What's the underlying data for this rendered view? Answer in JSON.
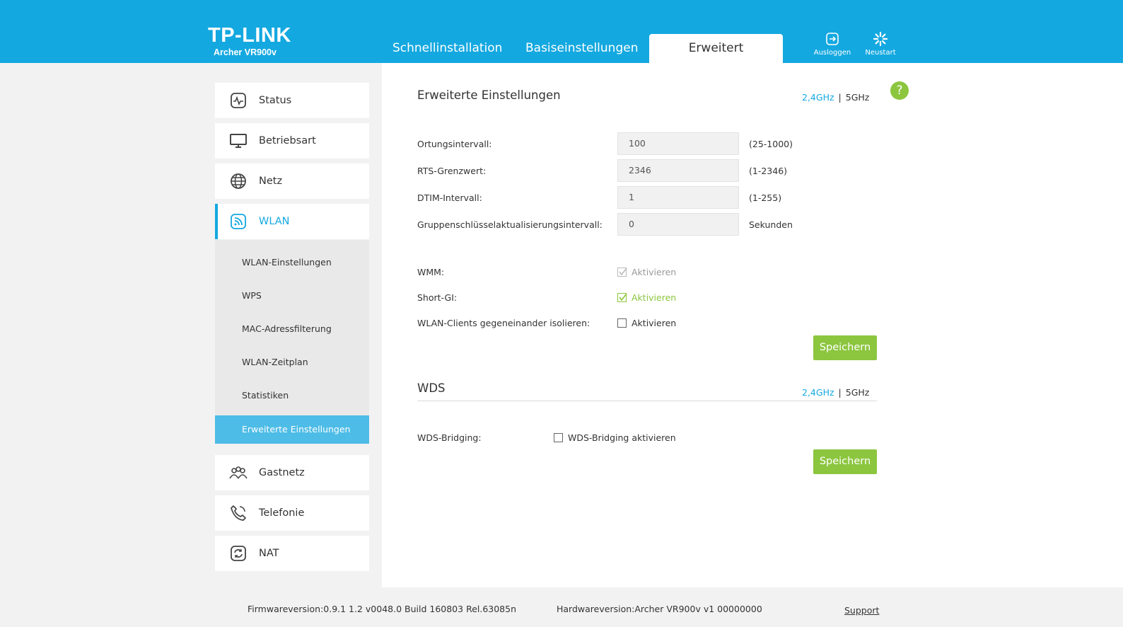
{
  "header": {
    "brand": "TP-LINK",
    "model": "Archer VR900v",
    "tabs": [
      "Schnellinstallation",
      "Basiseinstellungen",
      "Erweitert"
    ],
    "logout_label": "Ausloggen",
    "reboot_label": "Neustart",
    "color": "#14a8e0"
  },
  "sidebar": {
    "items": [
      {
        "label": "Status",
        "icon": "status-icon"
      },
      {
        "label": "Betriebsart",
        "icon": "monitor-icon"
      },
      {
        "label": "Netz",
        "icon": "globe-icon"
      },
      {
        "label": "WLAN",
        "icon": "wifi-icon"
      },
      {
        "label": "Gastnetz",
        "icon": "guests-icon"
      },
      {
        "label": "Telefonie",
        "icon": "phone-icon"
      },
      {
        "label": "NAT",
        "icon": "nat-icon"
      }
    ],
    "wlan_sub": [
      "WLAN-Einstellungen",
      "WPS",
      "MAC-Adressfilterung",
      "WLAN-Zeitplan",
      "Statistiken",
      "Erweiterte Einstellungen"
    ]
  },
  "advanced": {
    "title": "Erweiterte Einstellungen",
    "band_24": "2,4GHz",
    "band_sep": "|",
    "band_5": "5GHz",
    "help": "?",
    "fields": [
      {
        "label": "Ortungsintervall:",
        "value": "100",
        "hint": "(25-1000)"
      },
      {
        "label": "RTS-Grenzwert:",
        "value": "2346",
        "hint": "(1-2346)"
      },
      {
        "label": "DTIM-Intervall:",
        "value": "1",
        "hint": "(1-255)"
      },
      {
        "label": "Gruppenschlüsselaktualisierungsintervall:",
        "value": "0",
        "hint": "Sekunden"
      }
    ],
    "checks": [
      {
        "label": "WMM:",
        "option": "Aktivieren",
        "checked": true,
        "disabled": true
      },
      {
        "label": "Short-GI:",
        "option": "Aktivieren",
        "checked": true,
        "disabled": false
      },
      {
        "label": "WLAN-Clients gegeneinander isolieren:",
        "option": "Aktivieren",
        "checked": false,
        "disabled": false
      }
    ],
    "save": "Speichern"
  },
  "wds": {
    "title": "WDS",
    "band_24": "2,4GHz",
    "band_sep": "|",
    "band_5": "5GHz",
    "label": "WDS-Bridging:",
    "option": "WDS-Bridging aktivieren",
    "checked": false,
    "save": "Speichern"
  },
  "footer": {
    "firmware": "Firmwareversion:0.9.1 1.2 v0048.0 Build 160803 Rel.63085n",
    "hardware": "Hardwareversion:Archer VR900v v1 00000000",
    "support": "Support"
  }
}
